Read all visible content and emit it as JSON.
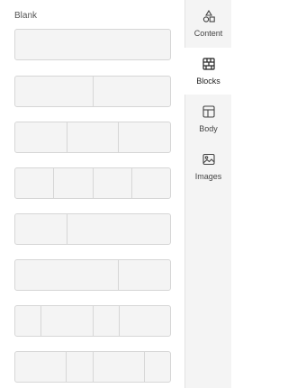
{
  "main": {
    "section_label": "Blank",
    "blocks": [
      {
        "name": "block-1-column",
        "columns": [
          1
        ]
      },
      {
        "name": "block-2-columns-equal",
        "columns": [
          1,
          1
        ]
      },
      {
        "name": "block-3-columns-equal",
        "columns": [
          1,
          1,
          1
        ]
      },
      {
        "name": "block-4-columns-equal",
        "columns": [
          1,
          1,
          1,
          1
        ]
      },
      {
        "name": "block-2-columns-1-2",
        "columns": [
          1,
          2
        ]
      },
      {
        "name": "block-2-columns-2-1",
        "columns": [
          2,
          1
        ]
      },
      {
        "name": "block-4-columns-1-2-1-2",
        "columns": [
          1,
          2,
          1,
          2
        ]
      },
      {
        "name": "block-4-columns-2-1-2-1",
        "columns": [
          2,
          1,
          2,
          1
        ]
      }
    ]
  },
  "sidebar": {
    "tabs": [
      {
        "label": "Content",
        "icon": "shapes-icon"
      },
      {
        "label": "Blocks",
        "icon": "blocks-icon",
        "active": true
      },
      {
        "label": "Body",
        "icon": "layout-icon"
      },
      {
        "label": "Images",
        "icon": "images-icon"
      }
    ]
  }
}
